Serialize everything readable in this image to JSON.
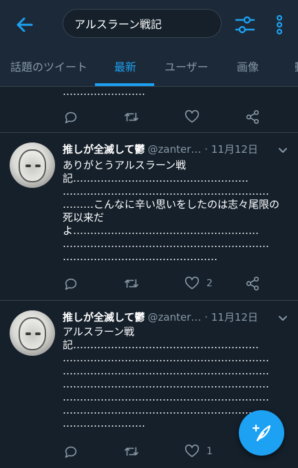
{
  "colors": {
    "background": "#15202b",
    "header": "#1c2938",
    "accent": "#1da1f2",
    "muted": "#8899a6"
  },
  "search": {
    "query": "アルスラーン戦記"
  },
  "tabs": [
    {
      "label": "話題のツイート"
    },
    {
      "label": "最新"
    },
    {
      "label": "ユーザー"
    },
    {
      "label": "画像"
    },
    {
      "label": "動"
    }
  ],
  "tweets": [
    {
      "text": "……………………",
      "reply_count": "",
      "retweet_count": "",
      "like_count": ""
    },
    {
      "author_name": "推しが全滅して鬱",
      "handle": "@zanter…",
      "date": "· 11月12日",
      "text": "ありがとうアルスラーン戦\n記……………………………………………\n……………………………………………………\n………こんなに辛い思いをしたのは志々尾限の\n死以来だ\nよ………………………………………………\n……………………………………………………\n………………………………………",
      "reply_count": "",
      "retweet_count": "",
      "like_count": "2"
    },
    {
      "author_name": "推しが全滅して鬱",
      "handle": "@zanter…",
      "date": "· 11月12日",
      "text": "アルスラーン戦\n記………………………………………………\n……………………………………………………\n……………………………………………………\n……………………………………………………\n……………………………………………………\n……………………………………………………\n……………………",
      "reply_count": "",
      "retweet_count": "",
      "like_count": "1"
    }
  ],
  "icons": {
    "back": "arrow-left-icon",
    "filter": "sliders-icon",
    "more": "vertical-ellipsis-icon",
    "reply": "speech-bubble-icon",
    "retweet": "retweet-icon",
    "like": "heart-icon",
    "share": "share-icon",
    "compose": "feather-plus-icon"
  }
}
